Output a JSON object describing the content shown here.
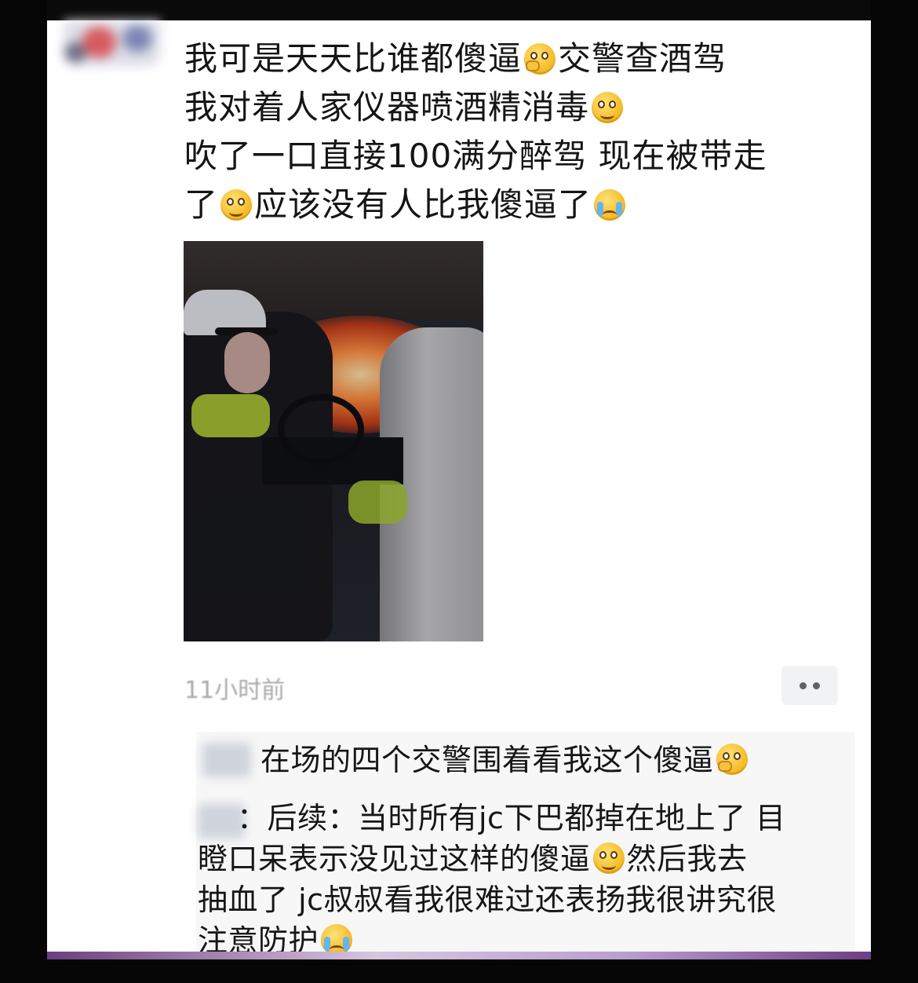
{
  "post": {
    "lines": [
      [
        "我可是天天比谁都傻逼",
        "交警查酒驾"
      ],
      [
        "我对着人家仪器喷酒精消毒",
        ""
      ],
      [
        "吹了一口直接100满分醉驾 现在被带走",
        ""
      ],
      [
        "了",
        "应该没有人比我傻逼了"
      ]
    ],
    "emojis": [
      "hand-over-mouth-emoji-icon",
      "smile-emoji-icon",
      "smile-emoji-icon",
      "crying-emoji-icon"
    ],
    "timestamp": "11小时前",
    "photo": "police-car-interior-photo"
  },
  "comments": [
    {
      "text": "在场的四个交警围着看我这个傻逼",
      "emoji": "hand-over-mouth-emoji-icon"
    },
    {
      "lines": [
        "：后续：当时所有jc下巴都掉在地上了 目",
        "瞪口呆表示没见过这样的傻逼",
        "然后我去",
        "抽血了 jc叔叔看我很难过还表扬我很讲究很",
        "注意防护"
      ],
      "emojis": [
        "smile-emoji-icon",
        "crying-emoji-icon"
      ]
    }
  ],
  "colors": {
    "text": "#151515",
    "timestamp": "#a9a9a9",
    "comment_bg": "#f7f7f7",
    "emoji_yellow": "#f4b71f"
  }
}
